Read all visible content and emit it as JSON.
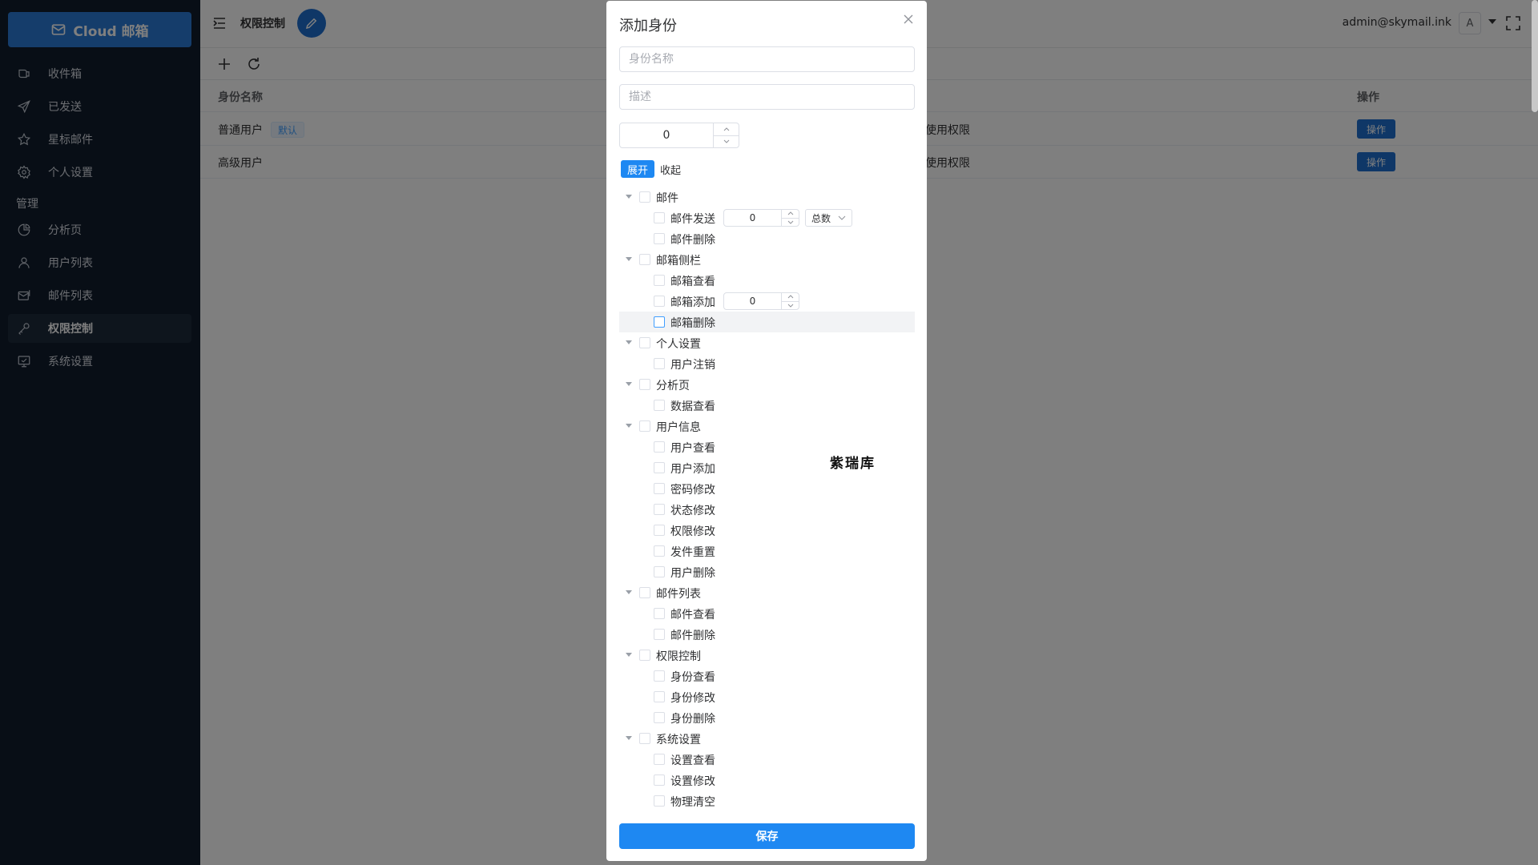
{
  "brand": {
    "label": "Cloud 邮箱"
  },
  "sidebar": {
    "items": [
      {
        "label": "收件箱",
        "icon": "inbox-icon"
      },
      {
        "label": "已发送",
        "icon": "send-icon"
      },
      {
        "label": "星标邮件",
        "icon": "star-icon"
      },
      {
        "label": "个人设置",
        "icon": "gear-icon"
      }
    ],
    "group_label": "管理",
    "admin_items": [
      {
        "label": "分析页",
        "icon": "pie-chart-icon"
      },
      {
        "label": "用户列表",
        "icon": "user-icon"
      },
      {
        "label": "邮件列表",
        "icon": "mail-list-icon"
      },
      {
        "label": "权限控制",
        "icon": "key-icon"
      },
      {
        "label": "系统设置",
        "icon": "monitor-icon"
      }
    ]
  },
  "header": {
    "title": "权限控制",
    "user_email": "admin@skymail.ink",
    "avatar_letter": "A"
  },
  "table": {
    "col_name": "身份名称",
    "col_desc_partial": "使用权限",
    "col_ops": "操作",
    "rows": [
      {
        "name": "普通用户",
        "tag": "默认",
        "desc": "使用权限",
        "op": "操作"
      },
      {
        "name": "高级用户",
        "tag": "",
        "desc": "使用权限",
        "op": "操作"
      }
    ]
  },
  "dialog": {
    "title": "添加身份",
    "name_placeholder": "身份名称",
    "desc_placeholder": "描述",
    "sort_value": "0",
    "expand_label": "展开",
    "collapse_label": "收起",
    "tree": [
      {
        "label": "邮件",
        "children": [
          {
            "label": "邮件发送",
            "number": "0",
            "select": "总数"
          },
          {
            "label": "邮件删除"
          }
        ]
      },
      {
        "label": "邮箱侧栏",
        "children": [
          {
            "label": "邮箱查看"
          },
          {
            "label": "邮箱添加",
            "number": "0"
          },
          {
            "label": "邮箱删除"
          }
        ]
      },
      {
        "label": "个人设置",
        "children": [
          {
            "label": "用户注销"
          }
        ]
      },
      {
        "label": "分析页",
        "children": [
          {
            "label": "数据查看"
          }
        ]
      },
      {
        "label": "用户信息",
        "children": [
          {
            "label": "用户查看"
          },
          {
            "label": "用户添加"
          },
          {
            "label": "密码修改"
          },
          {
            "label": "状态修改"
          },
          {
            "label": "权限修改"
          },
          {
            "label": "发件重置"
          },
          {
            "label": "用户删除"
          }
        ]
      },
      {
        "label": "邮件列表",
        "children": [
          {
            "label": "邮件查看"
          },
          {
            "label": "邮件删除"
          }
        ]
      },
      {
        "label": "权限控制",
        "children": [
          {
            "label": "身份查看"
          },
          {
            "label": "身份修改"
          },
          {
            "label": "身份删除"
          }
        ]
      },
      {
        "label": "系统设置",
        "children": [
          {
            "label": "设置查看"
          },
          {
            "label": "设置修改"
          },
          {
            "label": "物理清空"
          }
        ]
      }
    ],
    "save_label": "保存"
  },
  "watermark": "紫瑞库",
  "colors": {
    "sidebar_bg": "#111c2c",
    "primary": "#1e88f2",
    "brand": "#2a7bd6"
  }
}
